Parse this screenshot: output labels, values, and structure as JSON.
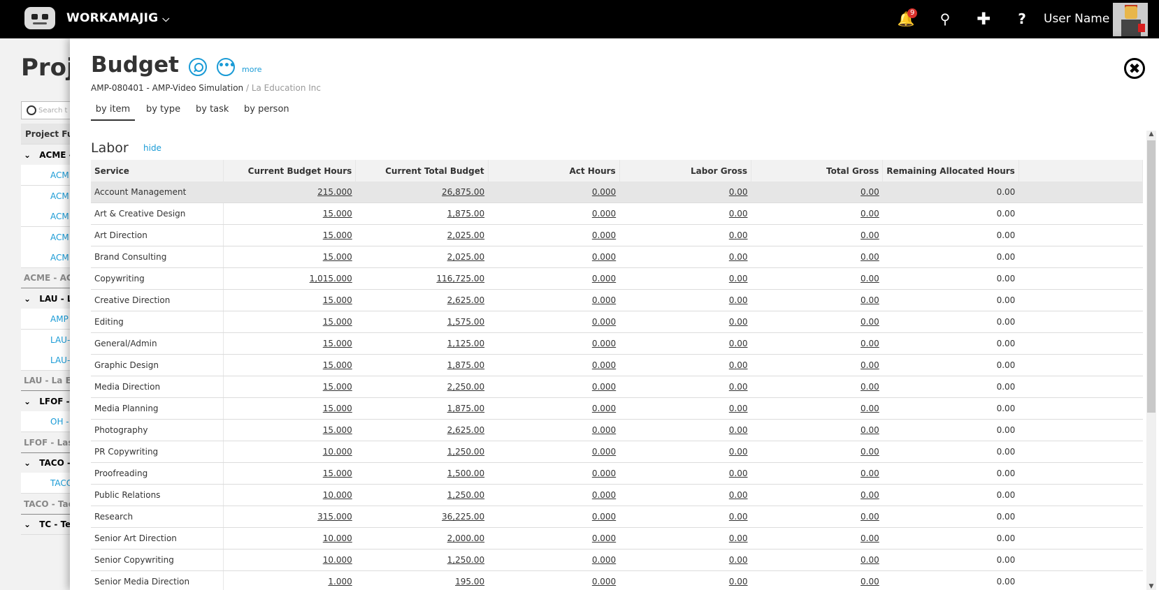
{
  "app": {
    "name": "WORKAMAJIG",
    "notification_count": "9",
    "user_name": "User Name"
  },
  "background_page": {
    "title": "Proje",
    "search_placeholder": "Search t",
    "header": "Project Ful",
    "rows": [
      {
        "text": "ACME -",
        "kind": "grp"
      },
      {
        "text": "ACM",
        "kind": "link"
      },
      {
        "text": "ACM",
        "kind": "link"
      },
      {
        "text": "ACM",
        "kind": "link"
      },
      {
        "text": "ACM",
        "kind": "link"
      },
      {
        "text": "ACM",
        "kind": "link"
      },
      {
        "text": "ACME - ACM",
        "kind": "sum"
      },
      {
        "text": "LAU - La",
        "kind": "grp"
      },
      {
        "text": "AMP",
        "kind": "link"
      },
      {
        "text": "LAU-",
        "kind": "link"
      },
      {
        "text": "LAU-",
        "kind": "link"
      },
      {
        "text": "LAU - La Ed",
        "kind": "sum"
      },
      {
        "text": "LFOF - L",
        "kind": "grp"
      },
      {
        "text": "OH -",
        "kind": "link"
      },
      {
        "text": "LFOF - Last",
        "kind": "sum"
      },
      {
        "text": "TACO -",
        "kind": "grp"
      },
      {
        "text": "TACO",
        "kind": "link"
      },
      {
        "text": "TACO - Tac",
        "kind": "sum"
      },
      {
        "text": "TC - Tes",
        "kind": "grp"
      }
    ]
  },
  "panel": {
    "title": "Budget",
    "more_label": "more",
    "project": "AMP-080401 - AMP-Video Simulation",
    "client": " / La Education Inc",
    "tabs": [
      "by item",
      "by type",
      "by task",
      "by person"
    ],
    "active_tab": "by item",
    "section_title": "Labor",
    "hide_label": "hide",
    "columns": [
      "Service",
      "Current Budget Hours",
      "Current Total Budget",
      "Act Hours",
      "Labor Gross",
      "Total Gross",
      "Remaining Allocated Hours"
    ],
    "rows": [
      [
        "Account Management",
        "215.000",
        "26,875.00",
        "0.000",
        "0.00",
        "0.00",
        "0.00"
      ],
      [
        "Art & Creative Design",
        "15.000",
        "1,875.00",
        "0.000",
        "0.00",
        "0.00",
        "0.00"
      ],
      [
        "Art Direction",
        "15.000",
        "2,025.00",
        "0.000",
        "0.00",
        "0.00",
        "0.00"
      ],
      [
        "Brand Consulting",
        "15.000",
        "2,025.00",
        "0.000",
        "0.00",
        "0.00",
        "0.00"
      ],
      [
        "Copywriting",
        "1,015.000",
        "116,725.00",
        "0.000",
        "0.00",
        "0.00",
        "0.00"
      ],
      [
        "Creative Direction",
        "15.000",
        "2,625.00",
        "0.000",
        "0.00",
        "0.00",
        "0.00"
      ],
      [
        "Editing",
        "15.000",
        "1,575.00",
        "0.000",
        "0.00",
        "0.00",
        "0.00"
      ],
      [
        "General/Admin",
        "15.000",
        "1,125.00",
        "0.000",
        "0.00",
        "0.00",
        "0.00"
      ],
      [
        "Graphic Design",
        "15.000",
        "1,875.00",
        "0.000",
        "0.00",
        "0.00",
        "0.00"
      ],
      [
        "Media Direction",
        "15.000",
        "2,250.00",
        "0.000",
        "0.00",
        "0.00",
        "0.00"
      ],
      [
        "Media Planning",
        "15.000",
        "1,875.00",
        "0.000",
        "0.00",
        "0.00",
        "0.00"
      ],
      [
        "Photography",
        "15.000",
        "2,625.00",
        "0.000",
        "0.00",
        "0.00",
        "0.00"
      ],
      [
        "PR Copywriting",
        "10.000",
        "1,250.00",
        "0.000",
        "0.00",
        "0.00",
        "0.00"
      ],
      [
        "Proofreading",
        "15.000",
        "1,500.00",
        "0.000",
        "0.00",
        "0.00",
        "0.00"
      ],
      [
        "Public Relations",
        "10.000",
        "1,250.00",
        "0.000",
        "0.00",
        "0.00",
        "0.00"
      ],
      [
        "Research",
        "315.000",
        "36,225.00",
        "0.000",
        "0.00",
        "0.00",
        "0.00"
      ],
      [
        "Senior Art Direction",
        "10.000",
        "2,000.00",
        "0.000",
        "0.00",
        "0.00",
        "0.00"
      ],
      [
        "Senior Copywriting",
        "10.000",
        "1,250.00",
        "0.000",
        "0.00",
        "0.00",
        "0.00"
      ],
      [
        "Senior Media Direction",
        "1.000",
        "195.00",
        "0.000",
        "0.00",
        "0.00",
        "0.00"
      ]
    ]
  },
  "colors": {
    "accent": "#1a9bd6",
    "topbar": "#000000",
    "badge": "#d9302b"
  }
}
